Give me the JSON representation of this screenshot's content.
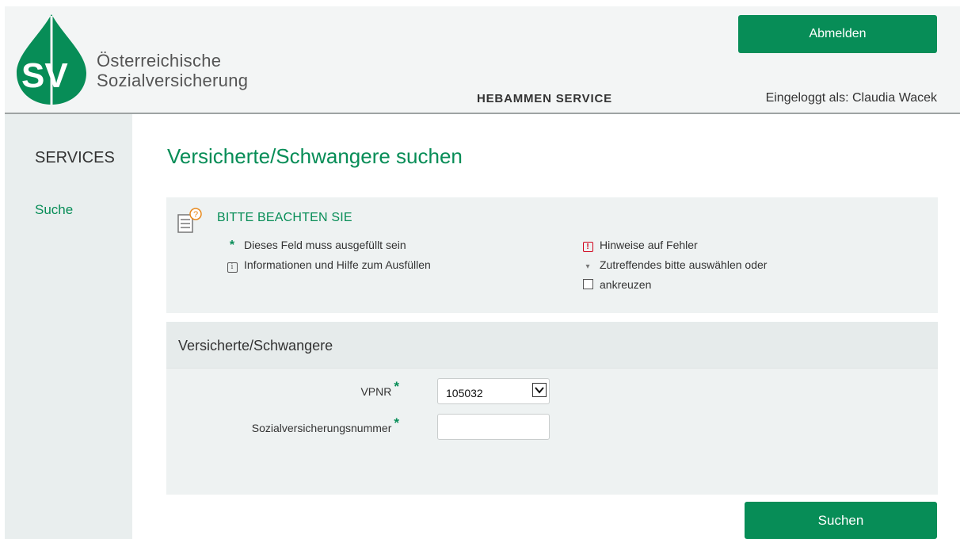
{
  "header": {
    "logo_text": "SV",
    "org_name_line1": "Österreichische",
    "org_name_line2": "Sozialversicherung",
    "service_title": "HEBAMMEN SERVICE",
    "logged_in_label": "Eingeloggt als: Claudia Wacek",
    "logout_label": "Abmelden"
  },
  "sidebar": {
    "heading": "SERVICES",
    "items": [
      {
        "label": "Suche"
      }
    ]
  },
  "main": {
    "title": "Versicherte/Schwangere suchen",
    "notice": {
      "title": "BITTE BEACHTEN SIE",
      "items": [
        {
          "symbol": "*",
          "icon": "required-star-icon",
          "text": "Dieses Feld muss ausgefüllt sein"
        },
        {
          "symbol": "i",
          "icon": "info-icon",
          "text": "Informationen und Hilfe zum Ausfüllen"
        },
        {
          "symbol": "!",
          "icon": "error-icon",
          "text": "Hinweise auf Fehler"
        },
        {
          "symbol": "▾",
          "icon": "select-dropdown-icon",
          "text": "Zutreffendes bitte auswählen oder"
        },
        {
          "symbol": "",
          "icon": "checkbox-icon",
          "text": "ankreuzen"
        }
      ]
    },
    "form": {
      "title": "Versicherte/Schwangere",
      "fields": {
        "vpnr": {
          "label": "VPNR",
          "required_mark": "*",
          "value": "105032"
        },
        "svnr": {
          "label": "Sozialversicherungsnummer",
          "required_mark": "*",
          "value": "",
          "placeholder": ""
        }
      }
    },
    "submit_label": "Suchen"
  },
  "colors": {
    "brand_green": "#078d57",
    "panel_bg": "#eef2f2",
    "sidebar_bg": "#e9eeee",
    "header_bg": "#f3f5f5",
    "error_red": "#d0021b"
  }
}
